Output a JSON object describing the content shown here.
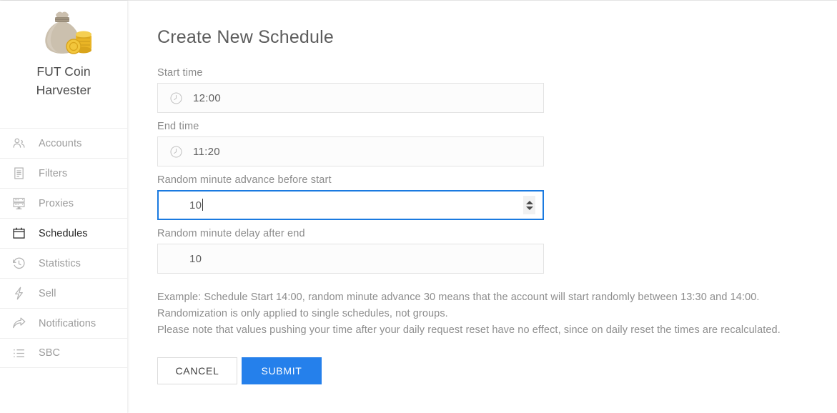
{
  "brand": {
    "logo_icon": "money-bag-coins-icon",
    "title_line1": "FUT Coin",
    "title_line2": "Harvester"
  },
  "sidebar": {
    "items": [
      {
        "label": "Accounts",
        "icon": "people-icon",
        "active": false
      },
      {
        "label": "Filters",
        "icon": "document-icon",
        "active": false
      },
      {
        "label": "Proxies",
        "icon": "server-rack-icon",
        "active": false
      },
      {
        "label": "Schedules",
        "icon": "calendar-icon",
        "active": true
      },
      {
        "label": "Statistics",
        "icon": "history-clock-icon",
        "active": false
      },
      {
        "label": "Sell",
        "icon": "lightning-icon",
        "active": false
      },
      {
        "label": "Notifications",
        "icon": "share-arrow-icon",
        "active": false
      },
      {
        "label": "SBC",
        "icon": "list-icon",
        "active": false
      }
    ]
  },
  "main": {
    "page_title": "Create New Schedule",
    "fields": [
      {
        "label": "Start time",
        "value": "12:00",
        "icon": "clock-icon",
        "type": "time",
        "focused": false,
        "spinner": false
      },
      {
        "label": "End time",
        "value": "11:20",
        "icon": "clock-icon",
        "type": "time",
        "focused": false,
        "spinner": false
      },
      {
        "label": "Random minute advance before start",
        "value": "10",
        "icon": "",
        "type": "number",
        "focused": true,
        "spinner": true
      },
      {
        "label": "Random minute delay after end",
        "value": "10",
        "icon": "",
        "type": "number",
        "focused": false,
        "spinner": false
      }
    ],
    "note_lines": [
      "Example: Schedule Start 14:00, random minute advance 30 means that the account will start randomly between 13:30 and 14:00.",
      "Randomization is only applied to single schedules, not groups.",
      "Please note that values pushing your time after your daily request reset have no effect, since on daily reset the times are recalculated."
    ],
    "buttons": {
      "cancel": "CANCEL",
      "submit": "SUBMIT"
    }
  },
  "colors": {
    "accent_blue": "#2580eb",
    "focus_border": "#1a7ae0",
    "text_muted": "#8d8d8d",
    "text_active": "#262626"
  }
}
